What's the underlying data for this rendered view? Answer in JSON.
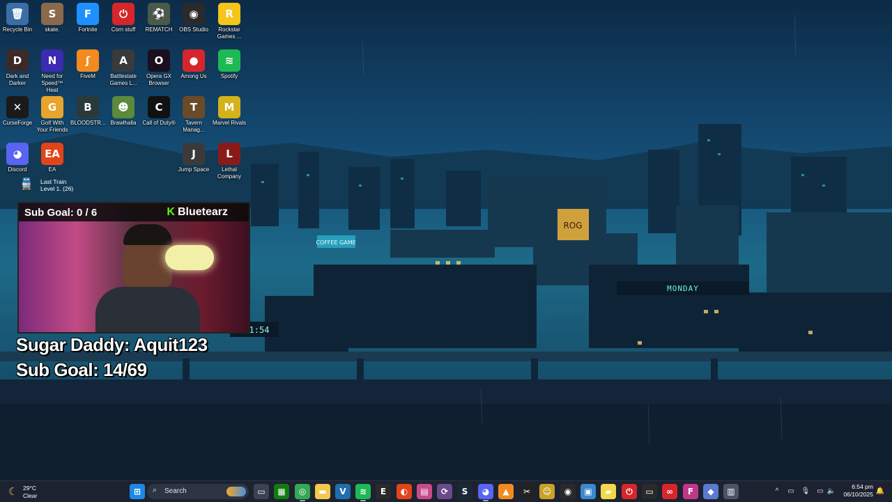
{
  "desktop_icons": [
    {
      "label": "Recycle Bin",
      "icon": "recycle-bin-icon",
      "color": "#3a6ea5",
      "glyph": "🗑"
    },
    {
      "label": "skate.",
      "icon": "skate-icon",
      "color": "#8a6a4a",
      "glyph": "S"
    },
    {
      "label": "Fortnite",
      "icon": "fortnite-icon",
      "color": "#1e90ff",
      "glyph": "F"
    },
    {
      "label": "Corn stuff",
      "icon": "power-icon",
      "color": "#d7262b",
      "glyph": "⏻"
    },
    {
      "label": "REMATCH",
      "icon": "rematch-icon",
      "color": "#4a5a4a",
      "glyph": "⚽"
    },
    {
      "label": "OBS Studio",
      "icon": "obs-icon",
      "color": "#2a2a2a",
      "glyph": "◉"
    },
    {
      "label": "Rockstar Games ...",
      "icon": "rockstar-icon",
      "color": "#f5c518",
      "glyph": "R"
    },
    {
      "label": "Dark and Darker",
      "icon": "dark-and-darker-icon",
      "color": "#3a2a2a",
      "glyph": "D"
    },
    {
      "label": "Need for Speed™ Heat",
      "icon": "nfs-icon",
      "color": "#3b2bb0",
      "glyph": "N"
    },
    {
      "label": "FiveM",
      "icon": "fivem-icon",
      "color": "#f28a1e",
      "glyph": "ʃ"
    },
    {
      "label": "Battlestate Games L...",
      "icon": "battlestate-icon",
      "color": "#3a3a3a",
      "glyph": "A"
    },
    {
      "label": "Opera GX Browser",
      "icon": "opera-gx-icon",
      "color": "#1a0f1f",
      "glyph": "O"
    },
    {
      "label": "Among Us",
      "icon": "among-us-icon",
      "color": "#d7262b",
      "glyph": "●"
    },
    {
      "label": "Spotify",
      "icon": "spotify-icon",
      "color": "#1db954",
      "glyph": "≋"
    },
    {
      "label": "CurseForge",
      "icon": "curseforge-icon",
      "color": "#1a1a1a",
      "glyph": "✕"
    },
    {
      "label": "Golf With Your Friends",
      "icon": "golf-icon",
      "color": "#e8a42b",
      "glyph": "G"
    },
    {
      "label": "BLOODSTR...",
      "icon": "bloodstrike-icon",
      "color": "#2a3a3a",
      "glyph": "B"
    },
    {
      "label": "Brawlhalla",
      "icon": "brawlhalla-icon",
      "color": "#5a8a3a",
      "glyph": "☻"
    },
    {
      "label": "Call of Duty®",
      "icon": "call-of-duty-icon",
      "color": "#111111",
      "glyph": "C"
    },
    {
      "label": "Tavern Manag...",
      "icon": "tavern-icon",
      "color": "#6b4a2a",
      "glyph": "T"
    },
    {
      "label": "Marvel Rivals",
      "icon": "marvel-rivals-icon",
      "color": "#d4b21a",
      "glyph": "M"
    },
    {
      "label": "Discord",
      "icon": "discord-icon",
      "color": "#5865f2",
      "glyph": "◕"
    },
    {
      "label": "EA",
      "icon": "ea-icon",
      "color": "#e2441a",
      "glyph": "EA"
    },
    {
      "label": "Jump Space",
      "icon": "jump-space-icon",
      "color": "#3a3a3a",
      "glyph": "J"
    },
    {
      "label": "Lethal Company",
      "icon": "lethal-company-icon",
      "color": "#8a1a1a",
      "glyph": "L"
    }
  ],
  "widget": {
    "title": "Last Train",
    "subtitle": "Level 1. (26)",
    "icon": "train-icon"
  },
  "stream_overlay": {
    "cam_goal": "Sub Goal: 0 / 6",
    "brand": "Bluetearz",
    "brand_logo": "K",
    "line1": "Sugar Daddy: Aquit123",
    "line2": "Sub Goal: 14/69"
  },
  "wallpaper_text": {
    "timer": "1:54",
    "sign1": "ROG",
    "sign2": "MONDAY",
    "sign3": "COFFEE GAME"
  },
  "taskbar": {
    "weather": {
      "temp": "29°C",
      "condition": "Clear",
      "icon": "moon-icon"
    },
    "search_placeholder": "Search",
    "apps": [
      {
        "name": "start-button",
        "icon": "windows-icon",
        "color": "#1e88e5",
        "glyph": "⊞"
      },
      {
        "name": "file-explorer-button",
        "icon": "task-view-icon",
        "color": "#3a4254",
        "glyph": "▭"
      },
      {
        "name": "xbox-button",
        "icon": "xbox-icon",
        "color": "#107c10",
        "glyph": "▦"
      },
      {
        "name": "chrome-button",
        "icon": "chrome-icon",
        "color": "#34a853",
        "glyph": "◎"
      },
      {
        "name": "files-button",
        "icon": "folder-icon",
        "color": "#f2c94c",
        "glyph": "▬"
      },
      {
        "name": "vs-button",
        "icon": "vscode-icon",
        "color": "#1f6fb0",
        "glyph": "V"
      },
      {
        "name": "spotify-button",
        "icon": "spotify-icon",
        "color": "#1db954",
        "glyph": "≋"
      },
      {
        "name": "epic-button",
        "icon": "epic-games-icon",
        "color": "#2a2a2a",
        "glyph": "E"
      },
      {
        "name": "ea-button",
        "icon": "ea-icon",
        "color": "#e2441a",
        "glyph": "◐"
      },
      {
        "name": "clipboard-button",
        "icon": "clipboard-icon",
        "color": "#c74a8a",
        "glyph": "▤"
      },
      {
        "name": "app-button-1",
        "icon": "sync-icon",
        "color": "#6a4a8a",
        "glyph": "⟳"
      },
      {
        "name": "steam-button",
        "icon": "steam-icon",
        "color": "#1b2838",
        "glyph": "S"
      },
      {
        "name": "discord-button",
        "icon": "discord-icon",
        "color": "#5865f2",
        "glyph": "◕"
      },
      {
        "name": "vlc-button",
        "icon": "vlc-icon",
        "color": "#f28a1e",
        "glyph": "▲"
      },
      {
        "name": "capcut-button",
        "icon": "capcut-icon",
        "color": "#222222",
        "glyph": "✂"
      },
      {
        "name": "app-button-2",
        "icon": "smiley-icon",
        "color": "#c9a227",
        "glyph": "☺"
      },
      {
        "name": "obs-button",
        "icon": "obs-icon",
        "color": "#2a2a2a",
        "glyph": "◉"
      },
      {
        "name": "photos-button",
        "icon": "photos-icon",
        "color": "#3a8ad0",
        "glyph": "▣"
      },
      {
        "name": "sticky-notes-button",
        "icon": "sticky-notes-icon",
        "color": "#f2d84a",
        "glyph": "▰"
      },
      {
        "name": "power-app-button",
        "icon": "power-icon",
        "color": "#d7262b",
        "glyph": "⏻"
      },
      {
        "name": "terminal-button",
        "icon": "terminal-icon",
        "color": "#2a2a2a",
        "glyph": "▭"
      },
      {
        "name": "creative-cloud-button",
        "icon": "creative-cloud-icon",
        "color": "#d7262b",
        "glyph": "∞"
      },
      {
        "name": "fortnite-button",
        "icon": "fortnite-icon",
        "color": "#c2368a",
        "glyph": "F"
      },
      {
        "name": "app-button-3",
        "icon": "diamond-icon",
        "color": "#5a7ad0",
        "glyph": "◆"
      },
      {
        "name": "app-button-4",
        "icon": "gauge-icon",
        "color": "#4a5466",
        "glyph": "▥"
      }
    ],
    "clock": {
      "time": "6:54 pm",
      "date": "06/10/2025"
    }
  }
}
